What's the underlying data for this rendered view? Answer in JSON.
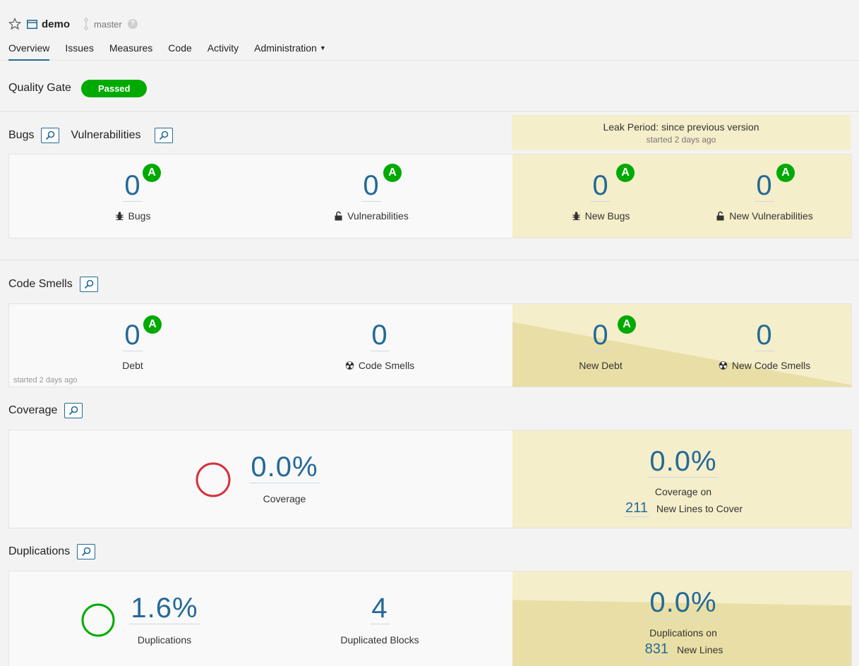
{
  "header": {
    "project_name": "demo",
    "branch": "master",
    "help": "?"
  },
  "nav": [
    {
      "label": "Overview"
    },
    {
      "label": "Issues"
    },
    {
      "label": "Measures"
    },
    {
      "label": "Code"
    },
    {
      "label": "Activity"
    },
    {
      "label": "Administration"
    }
  ],
  "quality_gate": {
    "label": "Quality Gate",
    "status": "Passed"
  },
  "leak_period": {
    "title": "Leak Period: since previous version",
    "started": "started 2 days ago"
  },
  "bugs_section": {
    "title_bugs": "Bugs",
    "title_vulns": "Vulnerabilities",
    "bugs": {
      "value": "0",
      "rating": "A",
      "label": "Bugs"
    },
    "vulnerabilities": {
      "value": "0",
      "rating": "A",
      "label": "Vulnerabilities"
    },
    "new_bugs": {
      "value": "0",
      "rating": "A",
      "label": "New Bugs"
    },
    "new_vulnerabilities": {
      "value": "0",
      "rating": "A",
      "label": "New Vulnerabilities"
    }
  },
  "smells_section": {
    "title": "Code Smells",
    "debt": {
      "value": "0",
      "rating": "A",
      "label": "Debt"
    },
    "code_smells": {
      "value": "0",
      "label": "Code Smells"
    },
    "new_debt": {
      "value": "0",
      "rating": "A",
      "label": "New Debt"
    },
    "new_code_smells": {
      "value": "0",
      "label": "New Code Smells"
    },
    "started_note": "started 2 days ago"
  },
  "coverage_section": {
    "title": "Coverage",
    "coverage": {
      "value": "0.0%",
      "label": "Coverage"
    },
    "new_coverage": {
      "value": "0.0%",
      "label": "Coverage on",
      "lines": "211",
      "lines_label": "New Lines to Cover"
    },
    "colors": {
      "donut": "#d4333f"
    }
  },
  "duplications_section": {
    "title": "Duplications",
    "duplications": {
      "value": "1.6%",
      "label": "Duplications"
    },
    "blocks": {
      "value": "4",
      "label": "Duplicated Blocks"
    },
    "new_duplications": {
      "value": "0.0%",
      "label": "Duplications on",
      "lines": "831",
      "lines_label": "New Lines"
    },
    "colors": {
      "donut": "#00aa00"
    }
  },
  "colors": {
    "link_blue": "#236a97",
    "rating_green": "#00aa00",
    "leak_yellow": "#f5eeca"
  }
}
